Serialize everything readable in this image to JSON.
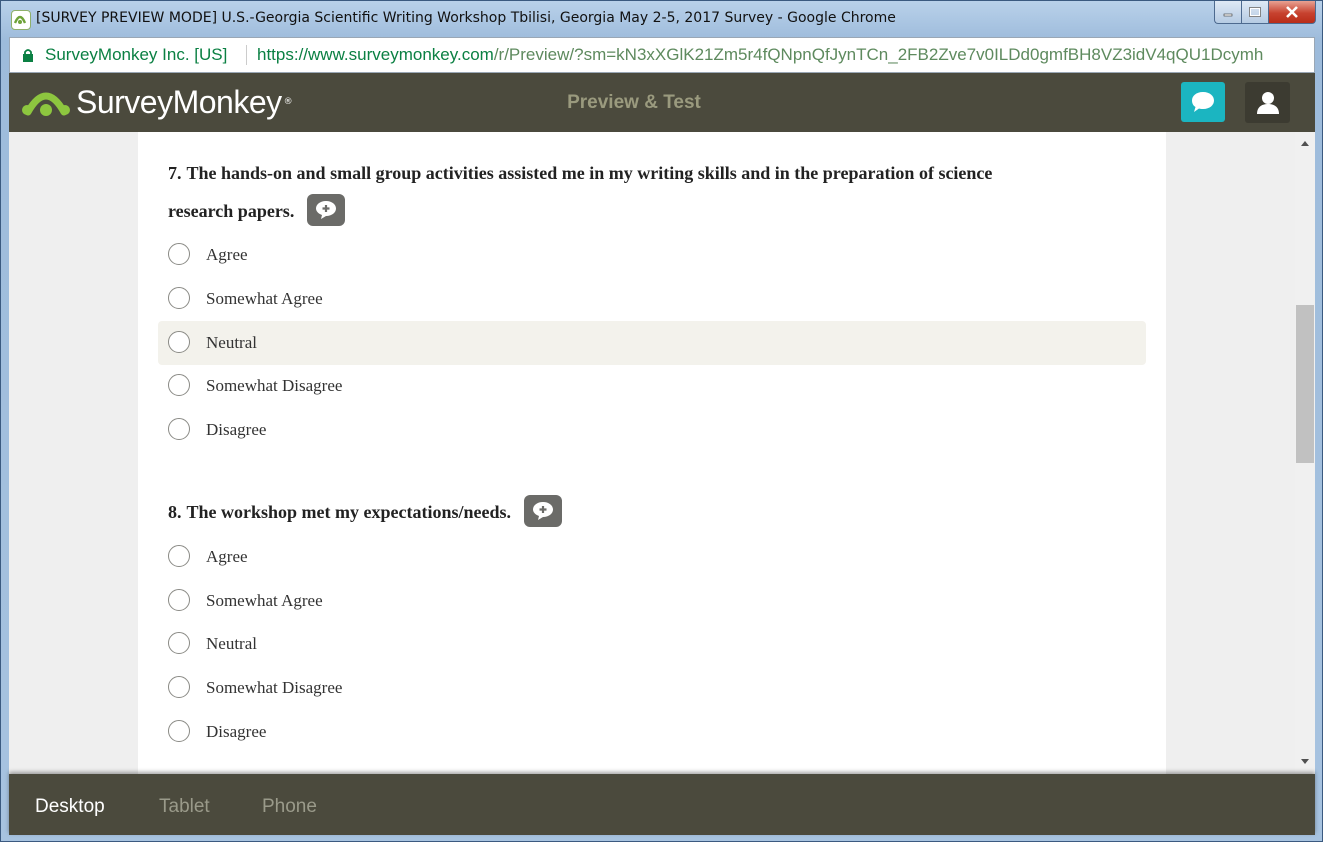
{
  "window": {
    "title": "[SURVEY PREVIEW MODE] U.S.-Georgia Scientific Writing Workshop Tbilisi, Georgia May 2-5, 2017 Survey - Google Chrome",
    "controls": [
      "minimize-icon",
      "maximize-icon",
      "close-icon"
    ]
  },
  "addressbar": {
    "site_identity": "SurveyMonkey Inc. [US]",
    "url_domain": "https://www.surveymonkey.com",
    "url_path": "/r/Preview/?sm=kN3xXGlK21Zm5r4fQNpnQfJynTCn_2FB2Zve7v0ILDd0gmfBH8VZ3idV4qQU1Dcymh"
  },
  "header": {
    "logo_text": "SurveyMonkey",
    "logo_mark": "®",
    "title": "Preview & Test",
    "chat_icon": "chat-bubble-icon",
    "user_icon": "user-icon"
  },
  "colors": {
    "header_bg": "#4b4a3d",
    "accent_teal": "#1bb5c1",
    "logo_green": "#8dc63f"
  },
  "questions": [
    {
      "number": "7.",
      "text_line1": "The hands-on and small group activities assisted me in my writing skills and in the preparation of science",
      "text_line2": "research papers.",
      "options": [
        "Agree",
        "Somewhat Agree",
        "Neutral",
        "Somewhat Disagree",
        "Disagree"
      ],
      "hovered": "Neutral"
    },
    {
      "number": "8.",
      "text": "The workshop met my expectations/needs.",
      "options": [
        "Agree",
        "Somewhat Agree",
        "Neutral",
        "Somewhat Disagree",
        "Disagree"
      ]
    }
  ],
  "device_tabs": [
    {
      "label": "Desktop",
      "active": true
    },
    {
      "label": "Tablet",
      "active": false
    },
    {
      "label": "Phone",
      "active": false
    }
  ]
}
